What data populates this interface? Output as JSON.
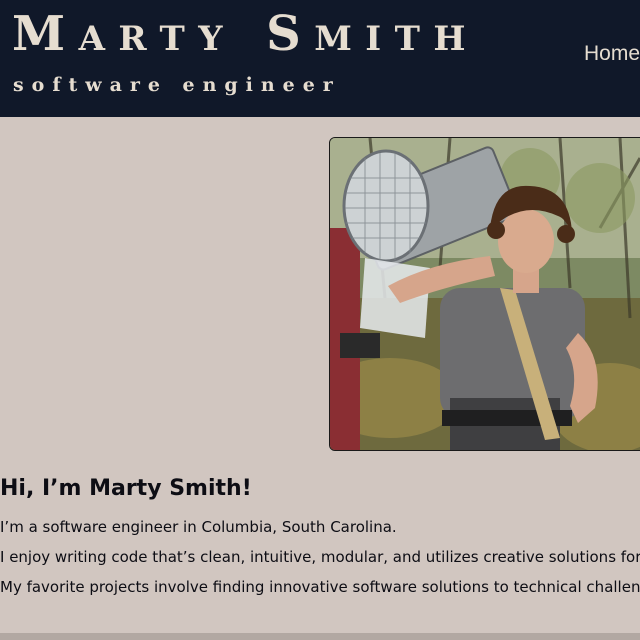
{
  "header": {
    "title": "Marty Smith",
    "subtitle": "software engineer",
    "nav": {
      "home": "Home"
    }
  },
  "photo": {
    "icon": "profile-photo"
  },
  "intro": {
    "greeting": "Hi, I’m Marty Smith!",
    "paragraphs": [
      "I’m a software engineer in Columbia, South Carolina.",
      "I enjoy writing code that’s clean, intuitive, modular, and utilizes creative solutions for effi",
      "My favorite projects involve finding innovative software solutions to technical challenge"
    ]
  },
  "colors": {
    "header_bg": "#101829",
    "page_bg": "#d1c6c0",
    "header_text": "#e6ddd0",
    "body_text": "#0d0d14"
  }
}
